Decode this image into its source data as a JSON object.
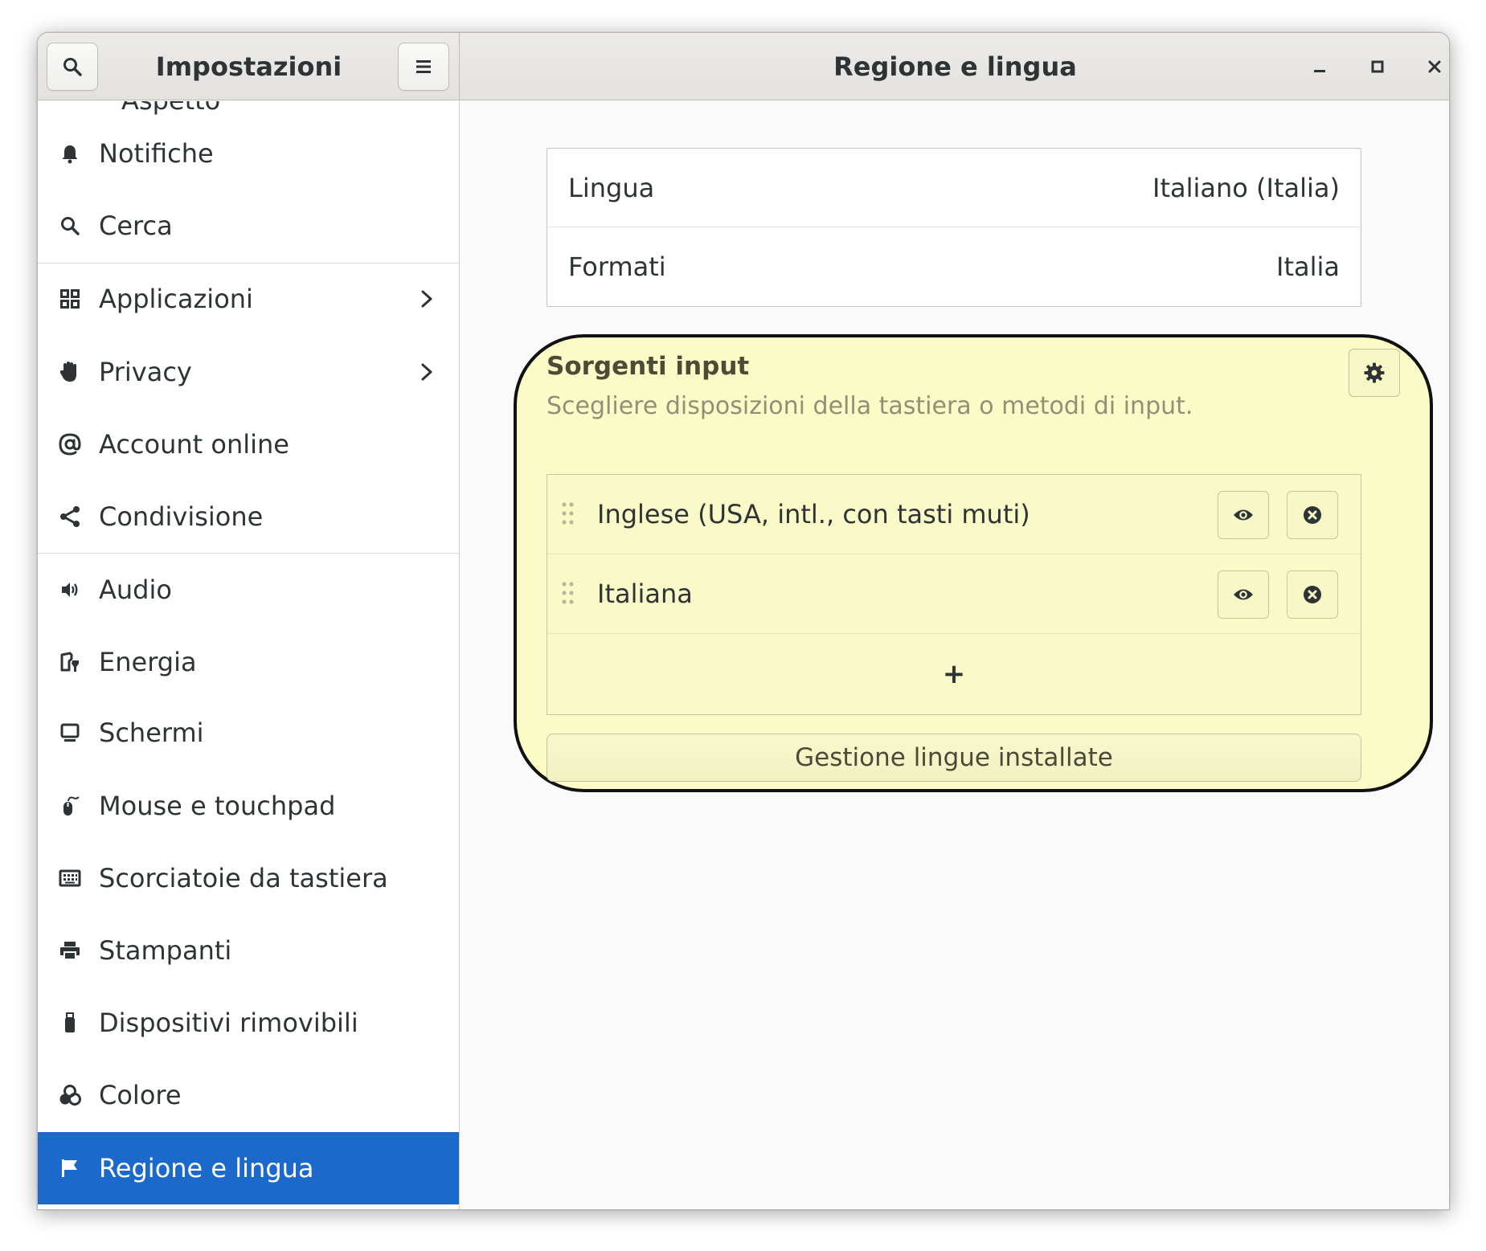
{
  "header": {
    "app_title": "Impostazioni",
    "page_title": "Regione e lingua"
  },
  "sidebar": {
    "partial_item": "Aspetto",
    "items": [
      {
        "label": "Notifiche",
        "icon": "bell-icon"
      },
      {
        "label": "Cerca",
        "icon": "search-icon"
      },
      {
        "label": "Applicazioni",
        "icon": "apps-grid-icon",
        "has_arrow": true
      },
      {
        "label": "Privacy",
        "icon": "hand-icon",
        "has_arrow": true
      },
      {
        "label": "Account online",
        "icon": "at-sign-icon"
      },
      {
        "label": "Condivisione",
        "icon": "share-icon"
      },
      {
        "label": "Audio",
        "icon": "speaker-icon"
      },
      {
        "label": "Energia",
        "icon": "battery-icon"
      },
      {
        "label": "Schermi",
        "icon": "monitor-icon"
      },
      {
        "label": "Mouse e touchpad",
        "icon": "mouse-icon"
      },
      {
        "label": "Scorciatoie da tastiera",
        "icon": "keyboard-icon"
      },
      {
        "label": "Stampanti",
        "icon": "printer-icon"
      },
      {
        "label": "Dispositivi rimovibili",
        "icon": "usb-drive-icon"
      },
      {
        "label": "Colore",
        "icon": "color-icon"
      },
      {
        "label": "Regione e lingua",
        "icon": "flag-icon",
        "selected": true
      }
    ]
  },
  "language": {
    "lingua_label": "Lingua",
    "lingua_value": "Italiano (Italia)",
    "formati_label": "Formati",
    "formati_value": "Italia"
  },
  "input_sources": {
    "title": "Sorgenti input",
    "description": "Scegliere disposizioni della tastiera o metodi di input.",
    "sources": [
      {
        "name": "Inglese (USA, intl., con tasti muti)"
      },
      {
        "name": "Italiana"
      }
    ],
    "add_label": "+",
    "manage_button": "Gestione lingue installate"
  },
  "colors": {
    "accent": "#1c69cc",
    "highlight_fill": "#fbfbc8",
    "highlight_border": "#111111"
  }
}
